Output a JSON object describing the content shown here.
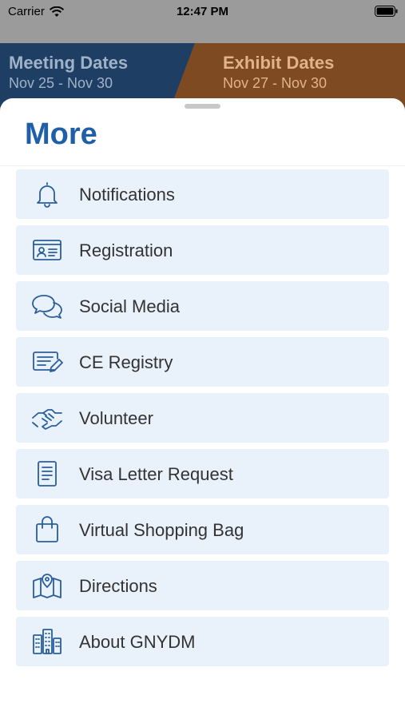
{
  "status_bar": {
    "carrier": "Carrier",
    "time": "12:47 PM"
  },
  "dates_banner": {
    "meeting": {
      "title": "Meeting Dates",
      "range": "Nov 25 - Nov 30"
    },
    "exhibit": {
      "title": "Exhibit Dates",
      "range": "Nov 27 - Nov 30"
    },
    "colors": {
      "meeting_bg": "#123c6b",
      "exhibit_bg": "#a45a1a"
    }
  },
  "sheet": {
    "title": "More"
  },
  "menu": {
    "items": [
      {
        "label": "Notifications",
        "icon": "bell-icon"
      },
      {
        "label": "Registration",
        "icon": "id-card-icon"
      },
      {
        "label": "Social Media",
        "icon": "chat-bubbles-icon"
      },
      {
        "label": "CE Registry",
        "icon": "form-edit-icon"
      },
      {
        "label": "Volunteer",
        "icon": "handshake-icon"
      },
      {
        "label": "Visa Letter Request",
        "icon": "document-icon"
      },
      {
        "label": "Virtual Shopping Bag",
        "icon": "shopping-bag-icon"
      },
      {
        "label": "Directions",
        "icon": "map-pin-icon"
      },
      {
        "label": "About GNYDM",
        "icon": "buildings-icon"
      }
    ]
  },
  "colors": {
    "accent": "#1f5fa8",
    "item_bg": "#e9f1fb",
    "icon_stroke": "#2a5e9c"
  }
}
